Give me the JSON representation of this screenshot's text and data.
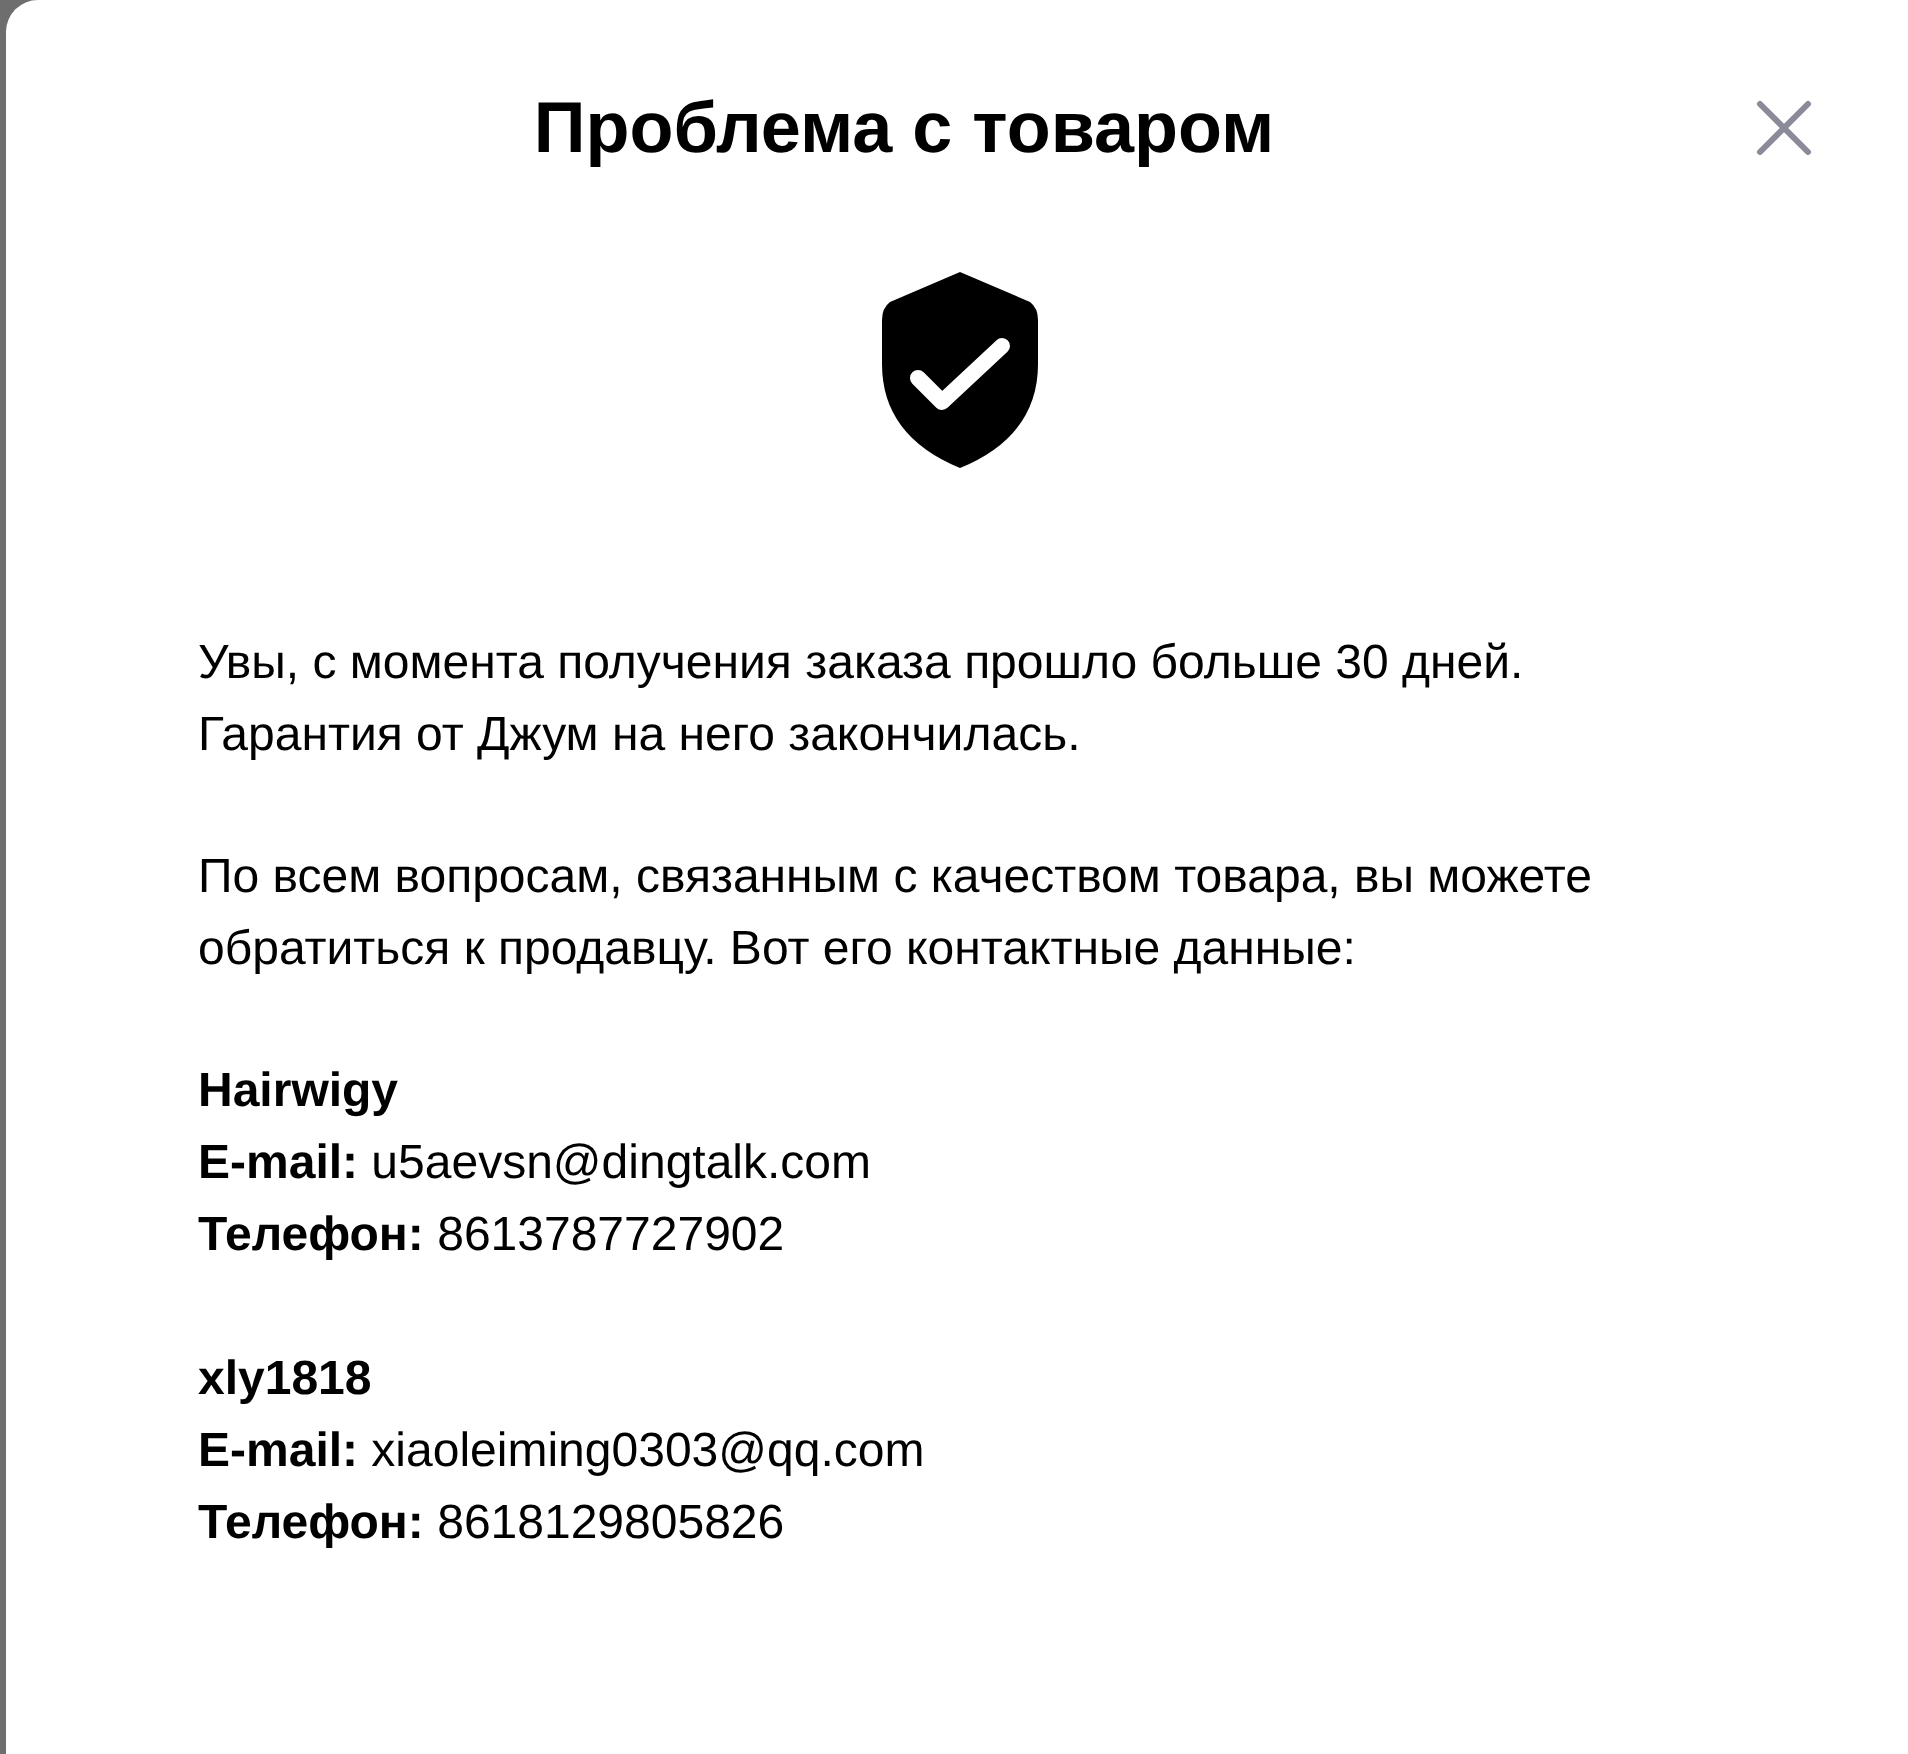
{
  "dialog": {
    "title": "Проблема с товаром",
    "paragraphs": [
      "Увы, с момента получения заказа прошло больше 30 дней. Гарантия от Джум на него закончилась.",
      "По всем вопросам, связанным с качеством товара, вы можете обратиться к продавцу. Вот его контактные данные:"
    ],
    "sellers": [
      {
        "name": "Hairwigy",
        "lines": [
          "**E-mail:** u5aevsn@dingtalk.com",
          "**Телефон:** 8613787727902"
        ]
      },
      {
        "name": "xly1818",
        "lines": [
          "**E-mail:** xiaoleiming0303@qq.com",
          "**Телефон:** 8618129805826"
        ]
      }
    ]
  }
}
